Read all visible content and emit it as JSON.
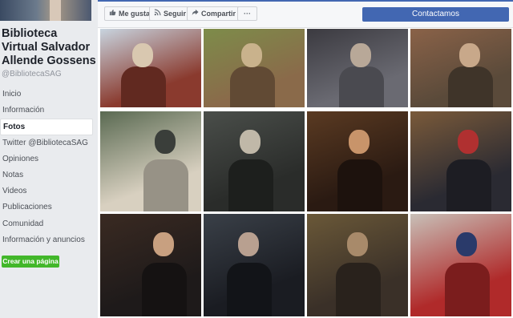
{
  "page": {
    "name": "Biblioteca Virtual Salvador Allende Gossens",
    "handle": "@BibliotecaSAG"
  },
  "sidebar": {
    "items": [
      {
        "label": "Inicio",
        "active": false
      },
      {
        "label": "Información",
        "active": false
      },
      {
        "label": "Fotos",
        "active": true
      },
      {
        "label": "Twitter @BibliotecaSAG",
        "active": false
      },
      {
        "label": "Opiniones",
        "active": false
      },
      {
        "label": "Notas",
        "active": false
      },
      {
        "label": "Videos",
        "active": false
      },
      {
        "label": "Publicaciones",
        "active": false
      },
      {
        "label": "Comunidad",
        "active": false
      },
      {
        "label": "Información y anuncios",
        "active": false
      }
    ],
    "create_page_label": "Crear una página"
  },
  "actions": {
    "like_label": "Me gusta",
    "follow_label": "Seguir",
    "share_label": "Compartir",
    "more_label": "···",
    "contact_label": "Contactamos"
  },
  "colors": {
    "brand": "#4267b2",
    "create_button": "#42b72a",
    "background": "#e9ebee"
  },
  "photos": [
    {
      "row": 0,
      "col": 0,
      "palette": [
        "#c8d4df",
        "#8a3a2e",
        "#d9c8b0"
      ]
    },
    {
      "row": 0,
      "col": 1,
      "palette": [
        "#7d8c4a",
        "#8a6a4a",
        "#c9b28c"
      ]
    },
    {
      "row": 0,
      "col": 2,
      "palette": [
        "#3b3a40",
        "#6a6a72",
        "#b8a898"
      ]
    },
    {
      "row": 0,
      "col": 3,
      "palette": [
        "#8a6248",
        "#5a4a3a",
        "#c8a88a"
      ]
    },
    {
      "row": 1,
      "col": 0,
      "palette": [
        "#5a6a52",
        "#d8d0c0",
        "#3a3e3a"
      ]
    },
    {
      "row": 1,
      "col": 1,
      "palette": [
        "#4a4e4a",
        "#2a2c2a",
        "#c0b8a8"
      ]
    },
    {
      "row": 1,
      "col": 2,
      "palette": [
        "#5a3a22",
        "#2a1a12",
        "#c8946a"
      ]
    },
    {
      "row": 1,
      "col": 3,
      "palette": [
        "#7a5a3a",
        "#2a2a32",
        "#b03030"
      ]
    },
    {
      "row": 2,
      "col": 0,
      "palette": [
        "#3a2a22",
        "#1e1a1a",
        "#c8a080"
      ]
    },
    {
      "row": 2,
      "col": 1,
      "palette": [
        "#3a4048",
        "#1a1c22",
        "#b8a090"
      ]
    },
    {
      "row": 2,
      "col": 2,
      "palette": [
        "#6a5838",
        "#3a3028",
        "#a88a6a"
      ]
    },
    {
      "row": 2,
      "col": 3,
      "palette": [
        "#c8c0b8",
        "#b02a2a",
        "#2a3a6a"
      ]
    }
  ]
}
